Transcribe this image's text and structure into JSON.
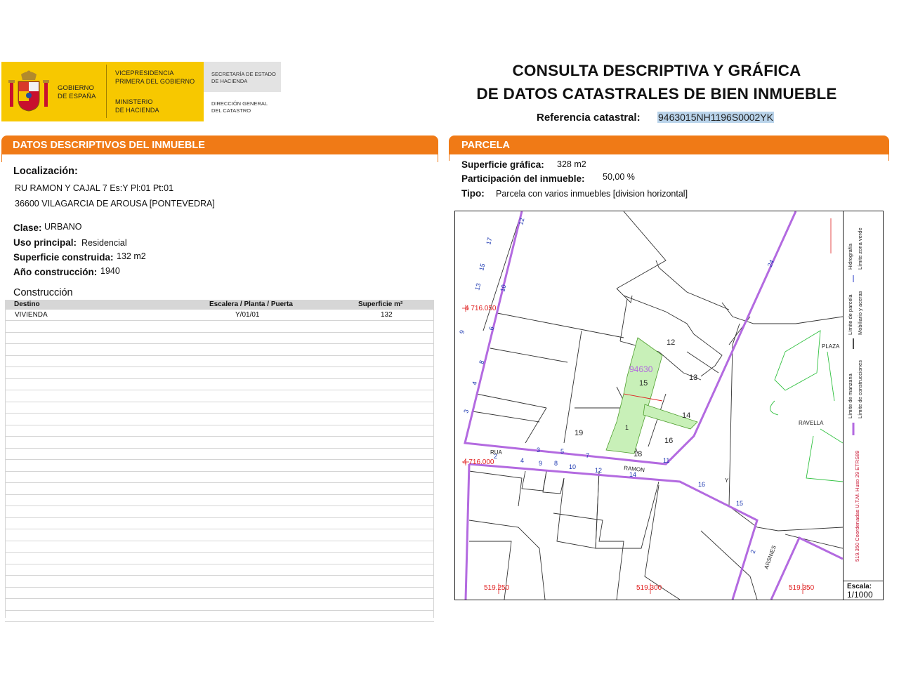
{
  "header": {
    "gov_line1": "GOBIERNO",
    "gov_line2": "DE ESPAÑA",
    "vp_line1": "VICEPRESIDENCIA",
    "vp_line2": "PRIMERA DEL GOBIERNO",
    "min_line1": "MINISTERIO",
    "min_line2": "DE HACIENDA",
    "sec_line1": "SECRETARÍA DE ESTADO",
    "sec_line2": "DE HACIENDA",
    "dir_line1": "DIRECCIÓN GENERAL",
    "dir_line2": "DEL CATASTRO",
    "title_line1": "CONSULTA DESCRIPTIVA Y GRÁFICA",
    "title_line2": "DE DATOS CATASTRALES DE BIEN INMUEBLE",
    "ref_label": "Referencia catastral:",
    "ref_value": "9463015NH1196S0002YK"
  },
  "colors": {
    "orange": "#f07a16",
    "yellow": "#f7c800",
    "gray_logo": "#e3e3e3",
    "purple": "#b36ae0",
    "green": "#c8f0b8",
    "highlight": "#b9d3ea"
  },
  "left": {
    "section_title_prefix": "DATOS DESCRIPTIVOS DEL",
    "section_title_bold": "INMUEBLE",
    "loc_label": "Localización:",
    "loc_line1": "RU RAMON Y CAJAL 7 Es:Y Pl:01 Pt:01",
    "loc_line2": "36600 VILAGARCIA DE AROUSA [PONTEVEDRA]",
    "clase_label": "Clase:",
    "clase_value": "URBANO",
    "uso_label": "Uso principal:",
    "uso_value": "Residencial",
    "sup_label": "Superficie construida:",
    "sup_value": "132 m2",
    "anio_label": "Año construcción:",
    "anio_value": "1940",
    "construccion_label": "Construcción",
    "table": {
      "headers": [
        "Destino",
        "Escalera / Planta / Puerta",
        "Superficie m²"
      ],
      "rows": [
        [
          "VIVIENDA",
          "Y/01/01",
          "132"
        ]
      ]
    }
  },
  "right": {
    "section_title": "PARCELA",
    "sup_label": "Superficie gráfica:",
    "sup_value": "328 m2",
    "part_label": "Participación del inmueble:",
    "part_value": "50,00 %",
    "tipo_label": "Tipo:",
    "tipo_value": "Parcela con varios inmuebles [division horizontal]"
  },
  "map": {
    "parcel_ref": "94630",
    "numbers": [
      "12",
      "13",
      "15",
      "14",
      "16",
      "19",
      "18",
      "11",
      "10",
      "12",
      "14",
      "16",
      "15",
      "24",
      "2",
      "4",
      "8",
      "9",
      "3",
      "5",
      "7",
      "1",
      "9",
      "10",
      "17",
      "15",
      "13",
      "12",
      "6",
      "8",
      "4",
      "3",
      "2"
    ],
    "labels": {
      "plaza": "PLAZA",
      "ravella": "RAVELLA",
      "rua": "RUA",
      "ramon": "RAMON",
      "y": "Y",
      "arsenes": "ARSNIES"
    },
    "coords": {
      "y_top": "4 716.050",
      "y_bottom": "4 716.000",
      "x1": "519.250",
      "x2": "519.300",
      "x3": "519.350"
    },
    "legend": {
      "l1a": "Límite zona verde",
      "l1b": "Hidrografía",
      "l2a": "Mobiliario y aceras",
      "l2b": "Límite de parcela",
      "l3a": "Límite de construcciones",
      "l3b": "Límite de manzana",
      "coords_note": "519.350 Coordenadas U.T.M. Huso 29 ETRS89"
    },
    "scale_label": "Escala:",
    "scale_value": "1/1000"
  }
}
